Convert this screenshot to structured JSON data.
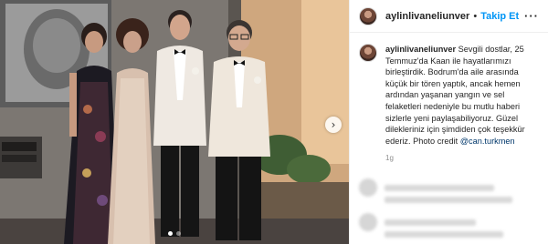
{
  "post": {
    "photo": {
      "alt_name": "wedding-photo",
      "carousel_dots": 2,
      "active_dot": 1
    },
    "header": {
      "username": "aylinlivaneliunver",
      "separator": "•",
      "follow_label": "Takip Et"
    },
    "caption": {
      "username": "aylinlivaneliunver",
      "text": "Sevgili dostlar, 25 Temmuz'da Kaan ile hayatlarımızı birleştirdik. Bodrum'da aile arasında küçük bir tören yaptık, ancak hemen ardından yaşanan yangın ve sel felaketleri nedeniyle bu mutlu haberi sizlerle yeni paylaşabiliyoruz. Güzel dilekleriniz için şimdiden çok teşekkür ederiz. Photo credit",
      "mention": "@can.turkmen"
    },
    "time_ago": "1g"
  },
  "icons": {
    "more": "more-options-icon",
    "next": "chevron-right-icon"
  },
  "colors": {
    "follow": "#0095f6",
    "mention": "#00376b",
    "muted": "#8e8e8e"
  }
}
